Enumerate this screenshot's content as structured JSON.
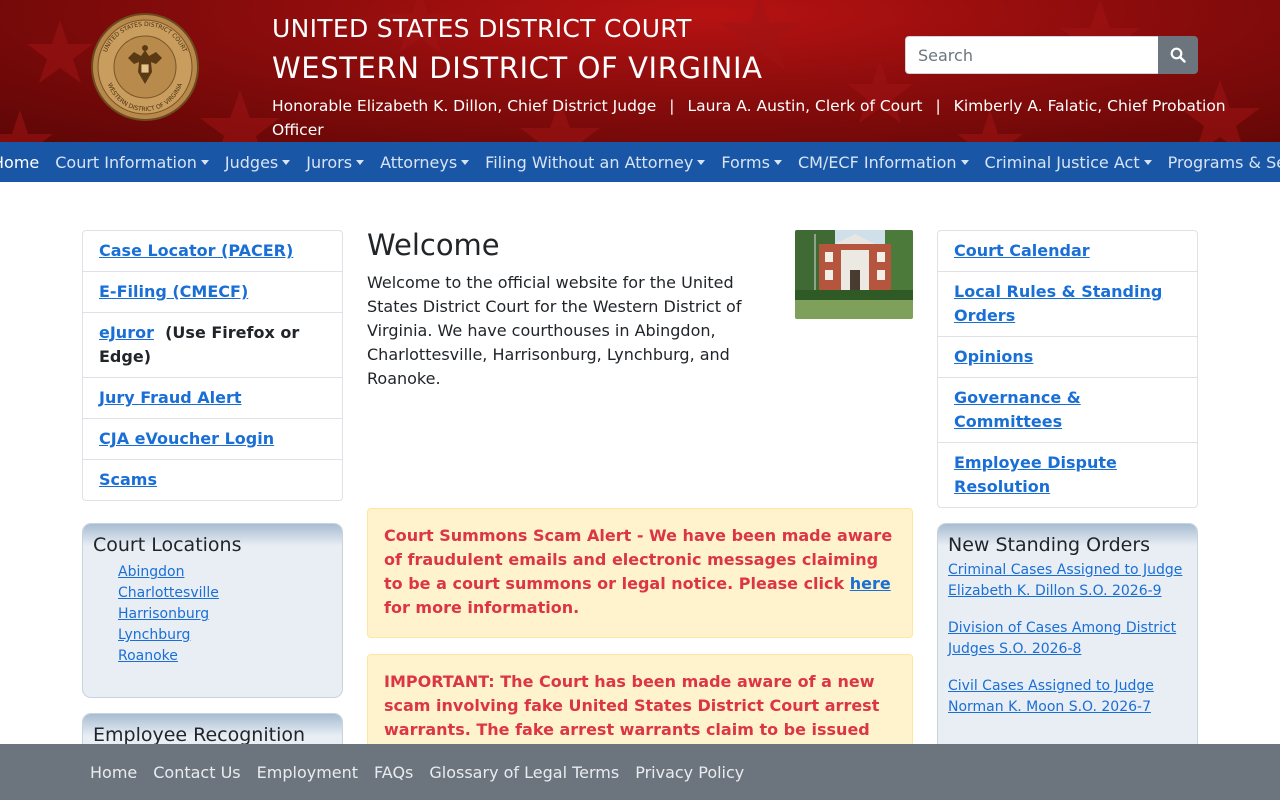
{
  "header": {
    "court_line1": "UNITED STATES DISTRICT COURT",
    "court_line2": "WESTERN DISTRICT OF VIRGINIA",
    "officers": [
      "Honorable Elizabeth K. Dillon, Chief District Judge",
      "Laura A. Austin, Clerk of Court",
      "Kimberly A. Falatic, Chief Probation Officer"
    ],
    "separator": "|",
    "search": {
      "placeholder": "Search",
      "icon": "search-icon"
    },
    "seal": {
      "top_text": "UNITED STATES DISTRICT COURT",
      "bottom_text": "WESTERN DISTRICT OF VIRGINIA"
    }
  },
  "nav": {
    "items": [
      {
        "label": "Home",
        "dropdown": false
      },
      {
        "label": "Court Information",
        "dropdown": true
      },
      {
        "label": "Judges",
        "dropdown": true
      },
      {
        "label": "Jurors",
        "dropdown": true
      },
      {
        "label": "Attorneys",
        "dropdown": true
      },
      {
        "label": "Filing Without an Attorney",
        "dropdown": true
      },
      {
        "label": "Forms",
        "dropdown": true
      },
      {
        "label": "CM/ECF Information",
        "dropdown": true
      },
      {
        "label": "Criminal Justice Act",
        "dropdown": true
      },
      {
        "label": "Programs & Services",
        "dropdown": true
      }
    ]
  },
  "left_links": {
    "items": [
      {
        "label": "Case Locator (PACER)"
      },
      {
        "label": "E-Filing (CMECF)"
      },
      {
        "label": "eJuror",
        "note": "(Use Firefox or Edge)"
      },
      {
        "label": "Jury Fraud Alert"
      },
      {
        "label": "CJA eVoucher Login"
      },
      {
        "label": "Scams"
      }
    ]
  },
  "court_locations": {
    "title": "Court Locations",
    "items": [
      "Abingdon",
      "Charlottesville",
      "Harrisonburg",
      "Lynchburg",
      "Roanoke"
    ]
  },
  "employee_recognition": {
    "title": "Employee Recognition"
  },
  "main": {
    "title": "Welcome",
    "text": "Welcome to the official website for the United States District Court for the Western District of Virginia. We have courthouses in Abingdon, Charlottesville, Harrisonburg, Lynchburg, and Roanoke.",
    "alerts": [
      {
        "text_before": "Court Summons Scam Alert - We have been made aware of fraudulent emails and electronic messages claiming to be a court summons or legal notice.  Please click ",
        "link": "here",
        "text_after": " for more information."
      },
      {
        "text": "IMPORTANT: The Court has been made aware of a new scam involving fake United States District Court arrest warrants. The fake arrest warrants claim to be issued"
      }
    ]
  },
  "right_links": {
    "items": [
      {
        "label": "Court Calendar"
      },
      {
        "label": "Local Rules & Standing Orders"
      },
      {
        "label": "Opinions"
      },
      {
        "label": "Governance & Committees"
      },
      {
        "label": "Employee Dispute Resolution"
      }
    ]
  },
  "standing_orders": {
    "title": "New Standing Orders",
    "items": [
      "Criminal Cases Assigned to Judge Elizabeth K. Dillon S.O. 2026-9",
      "Division of Cases Among District Judges S.O. 2026-8",
      "Civil Cases Assigned to Judge Norman K. Moon S.O. 2026-7"
    ]
  },
  "footer": {
    "links": [
      "Home",
      "Contact Us",
      "Employment",
      "FAQs",
      "Glossary of Legal Terms",
      "Privacy Policy"
    ]
  },
  "colors": {
    "header_red": "#8a0c0c",
    "nav_blue": "#1a56a6",
    "link_blue": "#1a6fd6",
    "alert_text": "#dc3545",
    "alert_bg": "#fff3cd",
    "footer_gray": "#6c757d"
  }
}
